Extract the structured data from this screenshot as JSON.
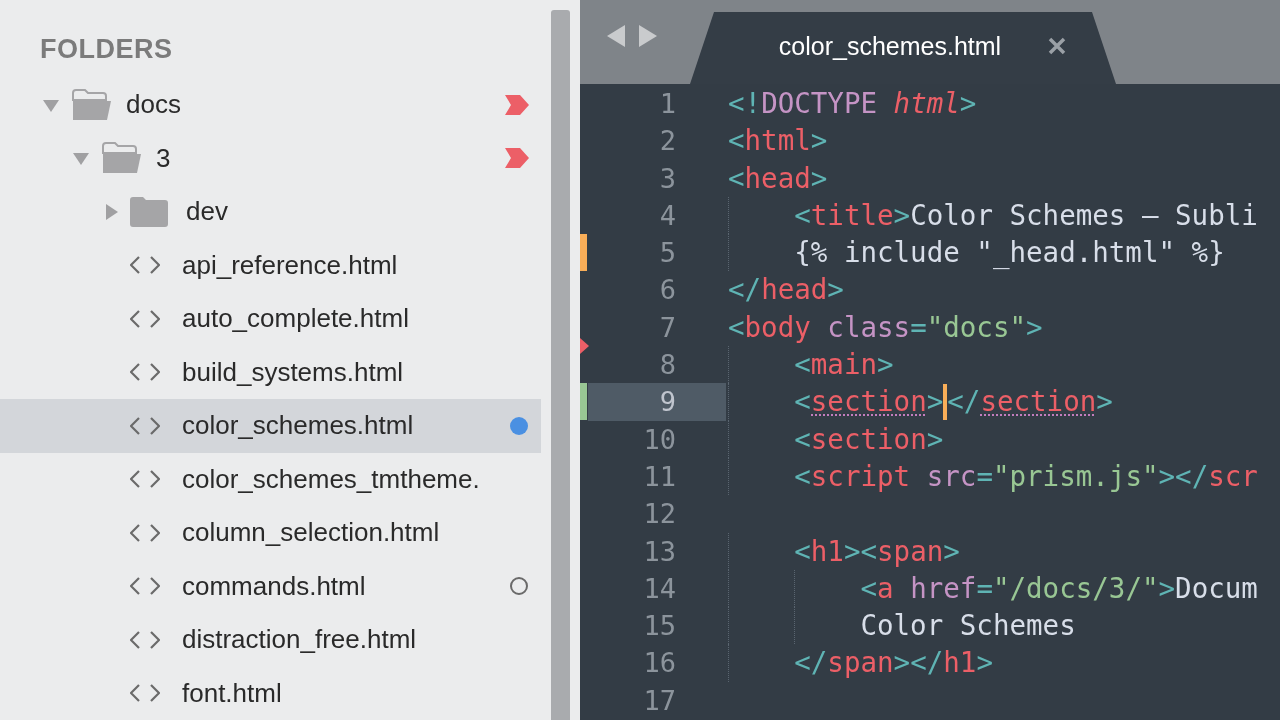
{
  "sidebar": {
    "title": "FOLDERS",
    "tree": [
      {
        "kind": "folder",
        "label": "docs",
        "expanded": true,
        "changed": true,
        "children": [
          {
            "kind": "folder",
            "label": "3",
            "expanded": true,
            "changed": true,
            "children": [
              {
                "kind": "folder",
                "label": "dev",
                "expanded": false,
                "changed": false
              },
              {
                "kind": "file",
                "label": "api_reference.html",
                "selected": false,
                "unsaved": false,
                "open": false
              },
              {
                "kind": "file",
                "label": "auto_complete.html",
                "selected": false,
                "unsaved": false,
                "open": false
              },
              {
                "kind": "file",
                "label": "build_systems.html",
                "selected": false,
                "unsaved": false,
                "open": false
              },
              {
                "kind": "file",
                "label": "color_schemes.html",
                "selected": true,
                "unsaved": true,
                "open": false
              },
              {
                "kind": "file",
                "label": "color_schemes_tmtheme.",
                "selected": false,
                "unsaved": false,
                "open": false
              },
              {
                "kind": "file",
                "label": "column_selection.html",
                "selected": false,
                "unsaved": false,
                "open": false
              },
              {
                "kind": "file",
                "label": "commands.html",
                "selected": false,
                "unsaved": false,
                "open": true
              },
              {
                "kind": "file",
                "label": "distraction_free.html",
                "selected": false,
                "unsaved": false,
                "open": false
              },
              {
                "kind": "file",
                "label": "font.html",
                "selected": false,
                "unsaved": false,
                "open": false
              }
            ]
          }
        ]
      }
    ]
  },
  "editor": {
    "tabs": [
      {
        "label": "color_schemes.html",
        "selected": true
      }
    ],
    "lines": [
      {
        "number": "1",
        "kind": "plain",
        "current": false,
        "tokens": [
          {
            "kind": "punct",
            "text": "<!"
          },
          {
            "kind": "doctype",
            "text": "DOCTYPE"
          },
          {
            "kind": "emph",
            "text": " html"
          },
          {
            "kind": "punct",
            "text": ">"
          }
        ]
      },
      {
        "number": "2",
        "kind": "plain",
        "current": false,
        "tokens": [
          {
            "kind": "punct",
            "text": "<"
          },
          {
            "kind": "tag",
            "text": "html"
          },
          {
            "kind": "punct",
            "text": ">"
          }
        ]
      },
      {
        "number": "3",
        "kind": "plain",
        "current": false,
        "tokens": [
          {
            "kind": "punct",
            "text": "<"
          },
          {
            "kind": "tag",
            "text": "head"
          },
          {
            "kind": "punct",
            "text": ">"
          }
        ]
      },
      {
        "number": "4",
        "kind": "plain",
        "current": false,
        "tokens": [
          {
            "kind": "punct",
            "text": "    <"
          },
          {
            "kind": "tag",
            "text": "title"
          },
          {
            "kind": "punct",
            "text": ">"
          },
          {
            "kind": "text",
            "text": "Color Schemes – Subli"
          }
        ]
      },
      {
        "number": "5",
        "kind": "modified",
        "current": false,
        "tokens": [
          {
            "kind": "text",
            "text": "    {% include \"_head.html\" %}"
          }
        ]
      },
      {
        "number": "6",
        "kind": "plain",
        "current": false,
        "tokens": [
          {
            "kind": "punct",
            "text": "</"
          },
          {
            "kind": "tag",
            "text": "head"
          },
          {
            "kind": "punct",
            "text": ">"
          }
        ]
      },
      {
        "number": "7",
        "kind": "plain",
        "current": false,
        "tokens": [
          {
            "kind": "punct",
            "text": "<"
          },
          {
            "kind": "tag",
            "text": "body"
          },
          {
            "kind": "attr",
            "text": " class"
          },
          {
            "kind": "punct",
            "text": "="
          },
          {
            "kind": "string",
            "text": "\"docs\""
          },
          {
            "kind": "punct",
            "text": ">"
          }
        ]
      },
      {
        "number": "8",
        "kind": "deleted",
        "current": false,
        "tokens": [
          {
            "kind": "punct",
            "text": "    <"
          },
          {
            "kind": "tag",
            "text": "main"
          },
          {
            "kind": "punct",
            "text": ">"
          }
        ]
      },
      {
        "number": "9",
        "kind": "added",
        "current": true,
        "tokens": [
          {
            "kind": "punct",
            "text": "    <"
          },
          {
            "kind": "tag",
            "text": "section",
            "matched": true
          },
          {
            "kind": "punct",
            "text": ">",
            "caret_after": true
          },
          {
            "kind": "punct",
            "text": "</"
          },
          {
            "kind": "tag",
            "text": "section",
            "matched": true
          },
          {
            "kind": "punct",
            "text": ">"
          }
        ]
      },
      {
        "number": "10",
        "kind": "plain",
        "current": false,
        "tokens": [
          {
            "kind": "punct",
            "text": "    <"
          },
          {
            "kind": "tag",
            "text": "section"
          },
          {
            "kind": "punct",
            "text": ">"
          }
        ]
      },
      {
        "number": "11",
        "kind": "plain",
        "current": false,
        "tokens": [
          {
            "kind": "punct",
            "text": "    <"
          },
          {
            "kind": "tag",
            "text": "script"
          },
          {
            "kind": "attr",
            "text": " src"
          },
          {
            "kind": "punct",
            "text": "="
          },
          {
            "kind": "string",
            "text": "\"prism.js\""
          },
          {
            "kind": "punct",
            "text": "></"
          },
          {
            "kind": "tag",
            "text": "scr"
          }
        ]
      },
      {
        "number": "12",
        "kind": "plain",
        "current": false
      },
      {
        "number": "13",
        "kind": "plain",
        "current": false,
        "tokens": [
          {
            "kind": "punct",
            "text": "    <"
          },
          {
            "kind": "tag",
            "text": "h1"
          },
          {
            "kind": "punct",
            "text": "><"
          },
          {
            "kind": "tag",
            "text": "span"
          },
          {
            "kind": "punct",
            "text": ">"
          }
        ]
      },
      {
        "number": "14",
        "kind": "plain",
        "current": false,
        "tokens": [
          {
            "kind": "punct",
            "text": "        <"
          },
          {
            "kind": "tag",
            "text": "a"
          },
          {
            "kind": "attr",
            "text": " href"
          },
          {
            "kind": "punct",
            "text": "="
          },
          {
            "kind": "string",
            "text": "\"/docs/3/\""
          },
          {
            "kind": "punct",
            "text": ">"
          },
          {
            "kind": "text",
            "text": "Docum"
          }
        ]
      },
      {
        "number": "15",
        "kind": "plain",
        "current": false,
        "tokens": [
          {
            "kind": "text",
            "text": "        Color Schemes"
          }
        ]
      },
      {
        "number": "16",
        "kind": "plain",
        "current": false,
        "tokens": [
          {
            "kind": "punct",
            "text": "    </"
          },
          {
            "kind": "tag",
            "text": "span"
          },
          {
            "kind": "punct",
            "text": "></"
          },
          {
            "kind": "tag",
            "text": "h1"
          },
          {
            "kind": "punct",
            "text": ">"
          }
        ]
      },
      {
        "number": "17",
        "kind": "plain",
        "current": false
      }
    ]
  }
}
